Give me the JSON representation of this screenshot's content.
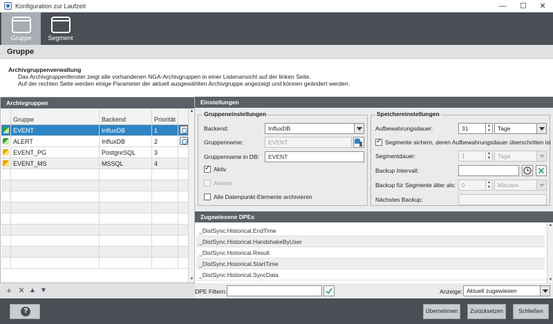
{
  "window": {
    "title": "Konfiguration zur Laufzeit",
    "minimize": "—",
    "maximize": "☐",
    "close": "✕"
  },
  "tabs": [
    {
      "label": "Gruppe"
    },
    {
      "label": "Segment"
    }
  ],
  "section": {
    "title": "Gruppe"
  },
  "description": {
    "title": "Archivgruppenverwaltung",
    "line1": "Das Archivgruppenfenster zeigt alle vorhandenen NGA-Archivgruppen in einer Listenansicht auf der linken Seite.",
    "line2": "Auf der rechten Seite werden einige Parameter der aktuell ausgewählten Archivgruppe angezeigt und können geändert werden."
  },
  "archive_groups": {
    "header": "Archivgruppen",
    "columns": {
      "group": "Gruppe",
      "backend": "Backend",
      "priority": "Priorität"
    },
    "rows": [
      {
        "name": "EVENT",
        "backend": "InfluxDB",
        "priority": "1",
        "status": "green"
      },
      {
        "name": "ALERT",
        "backend": "InfluxDB",
        "priority": "2",
        "status": "green"
      },
      {
        "name": "EVENT_PG",
        "backend": "PostgreSQL",
        "priority": "3",
        "status": "yellow"
      },
      {
        "name": "EVENT_MS",
        "backend": "MSSQL",
        "priority": "4",
        "status": "yellow"
      }
    ]
  },
  "settings": {
    "header": "Einstellungen",
    "group_settings": {
      "title": "Gruppeneinstellungen",
      "backend_label": "Backend:",
      "backend_value": "InfluxDB",
      "groupname_label": "Gruppenname:",
      "groupname_value": "EVENT",
      "groupname_db_label": "Gruppenname in DB:",
      "groupname_db_value": "EVENT",
      "active_label": "Aktiv",
      "active_checked": true,
      "alarms_label": "Alarme",
      "alarms_checked": false,
      "archive_all_label": "Alle Datenpunkt-Elemente archivieren",
      "archive_all_checked": false
    },
    "storage_settings": {
      "title": "Speichereinstellungen",
      "retention_label": "Aufbewahrungsdauer:",
      "retention_value": "31",
      "retention_unit": "Tage",
      "save_segments_label": "Segmente sichern, deren Aufbewahrungsdauer überschritten ist",
      "save_segments_checked": true,
      "segment_duration_label": "Segmentdauer:",
      "segment_duration_value": "1",
      "segment_duration_unit": "Tage",
      "backup_interval_label": "Backup Intervall:",
      "backup_interval_value": "",
      "backup_older_label": "Backup für Segmente älter als:",
      "backup_older_value": "0",
      "backup_older_unit": "Minuten",
      "next_backup_label": "Nächstes Backup:",
      "next_backup_value": ""
    }
  },
  "assigned_dpes": {
    "header": "Zugewiesene DPEs",
    "items": [
      "_DistSync.Historical.EndTime",
      "_DistSync.Historical.HandshakeByUser",
      "_DistSync.Historical.Result",
      "_DistSync.Historical.StartTime",
      "_DistSync.Historical.SyncData"
    ]
  },
  "filter": {
    "label": "DPE Filtern:",
    "value": "",
    "display_label": "Anzeige:",
    "display_value": "Aktuell zugewiesen"
  },
  "left_toolbar": {
    "add": "+",
    "delete": "✕",
    "up": "▲",
    "down": "▼"
  },
  "footer": {
    "help": "?",
    "apply": "Übernehmen",
    "reset": "Zurücksetzen",
    "close": "Schließen"
  },
  "colors": {
    "accent": "#2e84c3",
    "dark_bar": "#4a4f55",
    "panel_header": "#5b6066",
    "ok_green": "#2ea02e",
    "warn_yellow": "#e8a600"
  },
  "icons": {
    "status_ok": "status-green-icon",
    "status_warn": "status-yellow-icon",
    "clock": "clock-icon",
    "clear": "clear-icon",
    "check": "check-icon",
    "db_user": "db-user-icon"
  }
}
